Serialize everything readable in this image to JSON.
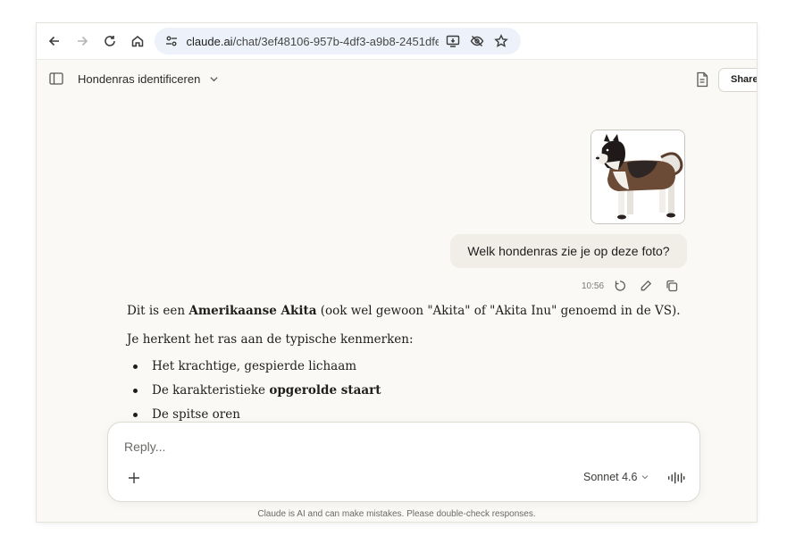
{
  "browser": {
    "url_host": "claude.ai",
    "url_path": "/chat/3ef48106-957b-4df3-a9b8-2451dfe...",
    "icons": [
      "back-arrow-icon",
      "forward-arrow-icon",
      "reload-icon",
      "home-icon",
      "site-settings-icon",
      "install-app-icon",
      "eye-off-icon",
      "star-icon"
    ]
  },
  "header": {
    "title": "Hondenras identificeren",
    "share_label": "Share"
  },
  "conversation": {
    "user_message": "Welk hondenras zie je op deze foto?",
    "user_time": "10:56",
    "assistant": {
      "p1_pre": "Dit is een ",
      "p1_bold": "Amerikaanse Akita",
      "p1_post": " (ook wel gewoon \"Akita\" of \"Akita Inu\" genoemd in de VS).",
      "p2": "Je herkent het ras aan de typische kenmerken:",
      "bullets": {
        "b1": "Het krachtige, gespierde lichaam",
        "b2_pre": "De karakteristieke ",
        "b2_bold": "opgerolde staart",
        "b3": "De spitse oren"
      }
    }
  },
  "composer": {
    "placeholder": "Reply...",
    "model": "Sonnet 4.6"
  },
  "footer": {
    "disclaimer": "Claude is AI and can make mistakes. Please double-check responses."
  },
  "colors": {
    "app_bg": "#faf9f5",
    "user_bubble": "#f0eee6",
    "omnibox": "#edf2fa"
  }
}
